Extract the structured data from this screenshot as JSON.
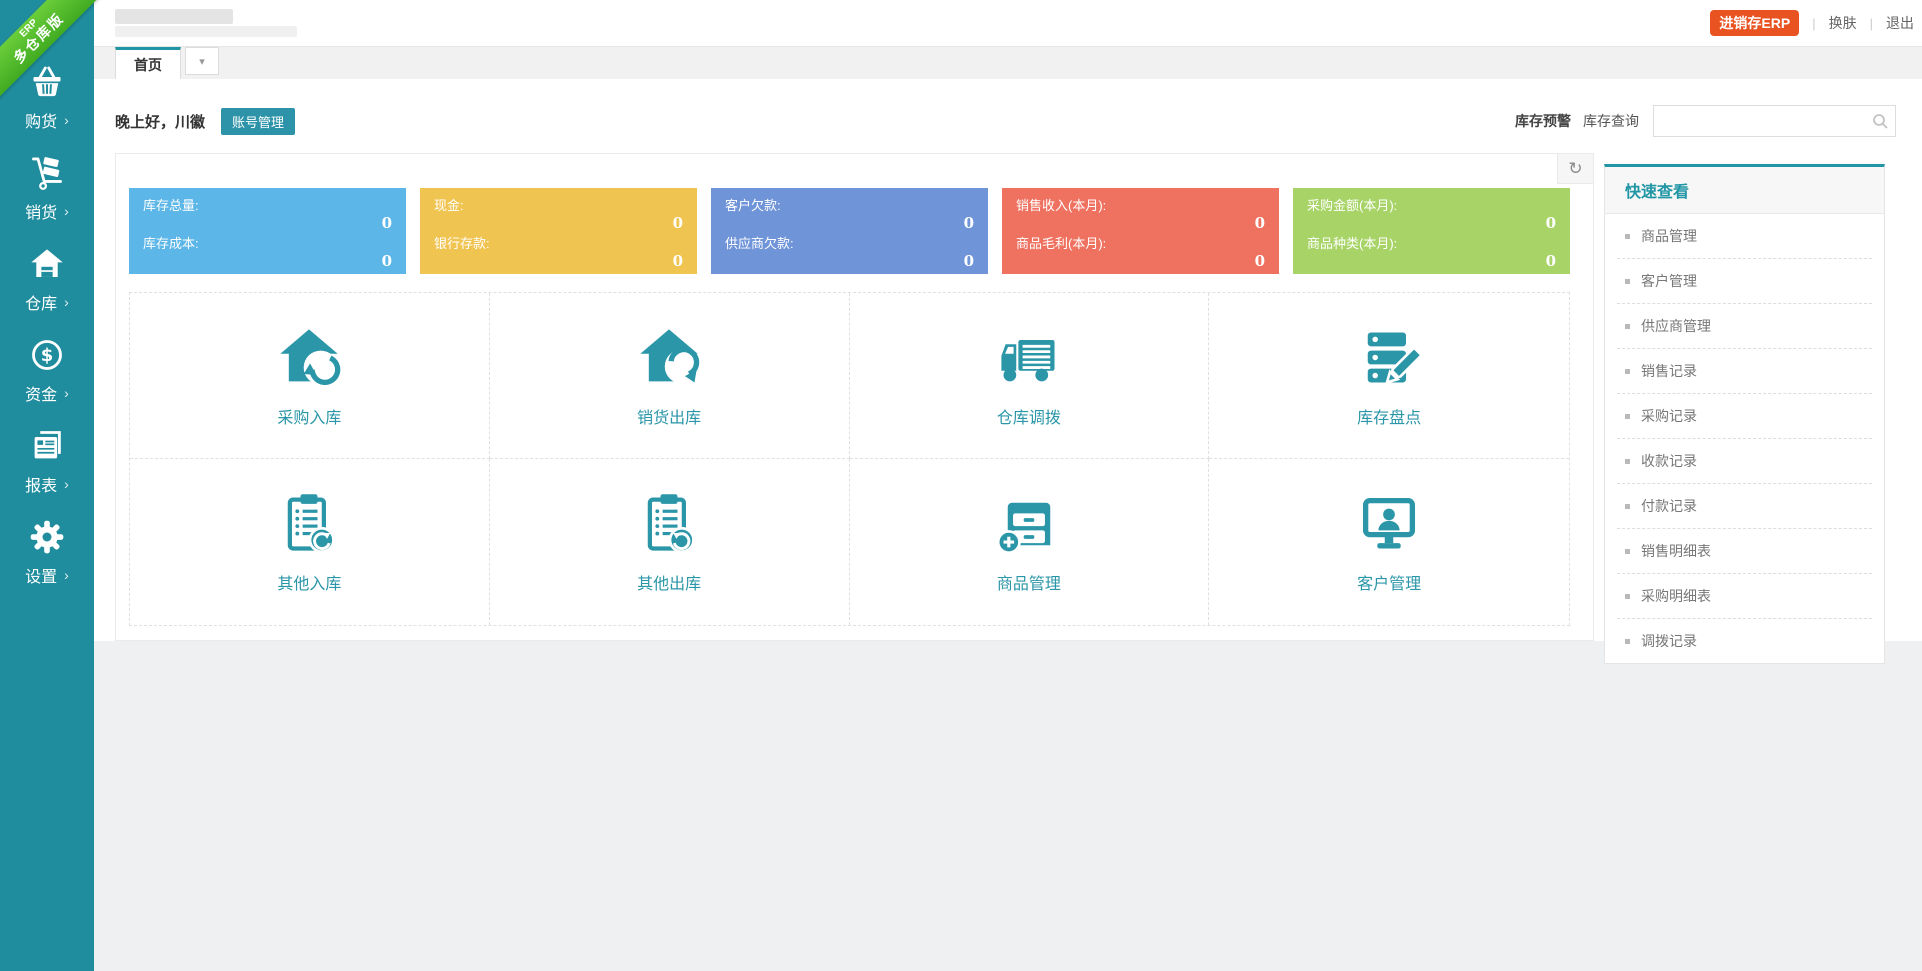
{
  "ribbon": {
    "line1": "ERP",
    "line2": "多仓库版"
  },
  "sidebar": {
    "chevron": "›",
    "items": [
      {
        "label": "购货"
      },
      {
        "label": "销货"
      },
      {
        "label": "仓库"
      },
      {
        "label": "资金"
      },
      {
        "label": "报表"
      },
      {
        "label": "设置"
      }
    ]
  },
  "header": {
    "erp_badge": "进销存ERP",
    "separator": "|",
    "skin_link": "换肤",
    "logout_link": "退出"
  },
  "tabs": {
    "home": "首页",
    "caret": "▾"
  },
  "greeting": {
    "text": "晚上好，川徽",
    "account_button": "账号管理"
  },
  "toolbar": {
    "stock_warning": "库存预警",
    "stock_query": "库存查询",
    "search_value": "",
    "search_placeholder": ""
  },
  "panel": {
    "refresh_icon": "↻"
  },
  "stats_cards": [
    {
      "color": "#5cb6e8",
      "rows": [
        {
          "label": "库存总量:",
          "value": "0"
        },
        {
          "label": "库存成本:",
          "value": "0"
        }
      ]
    },
    {
      "color": "#f0c451",
      "rows": [
        {
          "label": "现金:",
          "value": "0"
        },
        {
          "label": "银行存款:",
          "value": "0"
        }
      ]
    },
    {
      "color": "#7094d8",
      "rows": [
        {
          "label": "客户欠款:",
          "value": "0"
        },
        {
          "label": "供应商欠款:",
          "value": "0"
        }
      ]
    },
    {
      "color": "#ef7160",
      "rows": [
        {
          "label": "销售收入(本月):",
          "value": "0"
        },
        {
          "label": "商品毛利(本月):",
          "value": "0"
        }
      ]
    },
    {
      "color": "#a8d467",
      "rows": [
        {
          "label": "采购金额(本月):",
          "value": "0"
        },
        {
          "label": "商品种类(本月):",
          "value": "0"
        }
      ]
    }
  ],
  "shortcuts": [
    {
      "label": "采购入库"
    },
    {
      "label": "销货出库"
    },
    {
      "label": "仓库调拨"
    },
    {
      "label": "库存盘点"
    },
    {
      "label": "其他入库"
    },
    {
      "label": "其他出库"
    },
    {
      "label": "商品管理"
    },
    {
      "label": "客户管理"
    }
  ],
  "quickview": {
    "title": "快速查看",
    "items": [
      "商品管理",
      "客户管理",
      "供应商管理",
      "销售记录",
      "采购记录",
      "收款记录",
      "付款记录",
      "销售明细表",
      "采购明细表",
      "调拨记录"
    ]
  },
  "colors": {
    "sidebar": "#1f8d9e",
    "accent": "#2196a5",
    "icon_teal": "#2a96a8",
    "badge_orange": "#e95321"
  }
}
